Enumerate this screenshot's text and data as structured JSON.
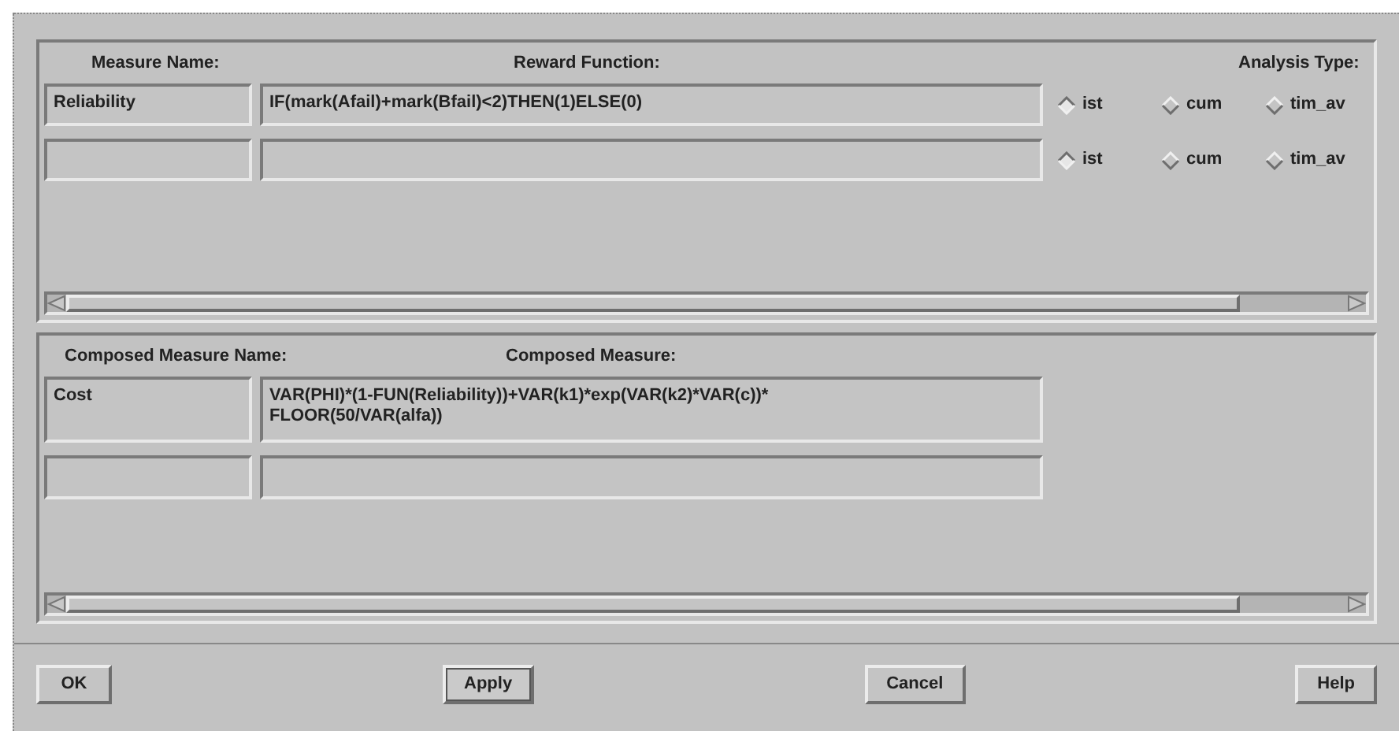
{
  "measures": {
    "headers": {
      "name": "Measure Name:",
      "function": "Reward Function:",
      "analysis": "Analysis Type:"
    },
    "rows": [
      {
        "name": "Reliability",
        "function": "IF(mark(Afail)+mark(Bfail)<2)THEN(1)ELSE(0)",
        "options": [
          {
            "label": "ist",
            "selected": true
          },
          {
            "label": "cum",
            "selected": false
          },
          {
            "label": "tim_av",
            "selected": false
          }
        ]
      },
      {
        "name": "",
        "function": "",
        "options": [
          {
            "label": "ist",
            "selected": true
          },
          {
            "label": "cum",
            "selected": false
          },
          {
            "label": "tim_av",
            "selected": false
          }
        ]
      }
    ]
  },
  "composed": {
    "headers": {
      "name": "Composed Measure Name:",
      "measure": "Composed Measure:"
    },
    "rows": [
      {
        "name": "Cost",
        "measure": "VAR(PHI)*(1-FUN(Reliability))+VAR(k1)*exp(VAR(k2)*VAR(c))*\nFLOOR(50/VAR(alfa))"
      },
      {
        "name": "",
        "measure": ""
      }
    ]
  },
  "buttons": [
    {
      "label": "OK",
      "default": false
    },
    {
      "label": "Apply",
      "default": true
    },
    {
      "label": "Cancel",
      "default": false
    },
    {
      "label": "Help",
      "default": false
    }
  ]
}
